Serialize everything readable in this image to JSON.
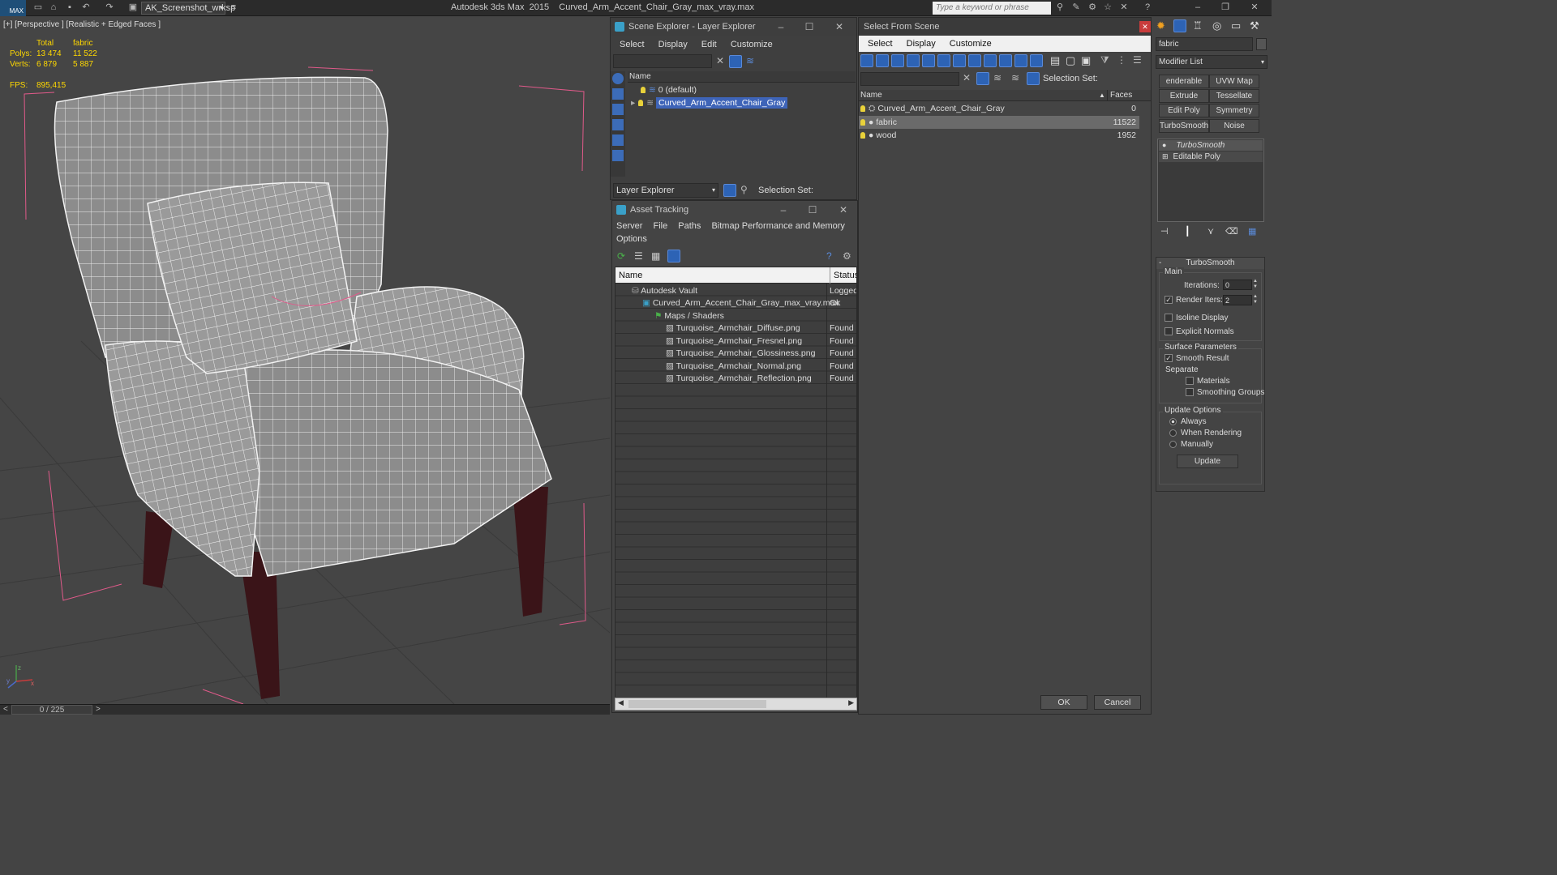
{
  "titlebar": {
    "logo": "MAX",
    "workspace": "AK_Screenshot_wrksp",
    "app_title": "Autodesk 3ds Max  2015    Curved_Arm_Accent_Chair_Gray_max_vray.max",
    "search_placeholder": "Type a keyword or phrase"
  },
  "viewport": {
    "label": "[+] [Perspective ] [Realistic + Edged Faces ]",
    "stats": {
      "col_total": "Total",
      "col_fabric": "fabric",
      "polys_label": "Polys:",
      "polys_total": "13 474",
      "polys_fabric": "11 522",
      "verts_label": "Verts:",
      "verts_total": "6 879",
      "verts_fabric": "5 887",
      "fps_label": "FPS:",
      "fps_value": "895,415"
    },
    "axis_x": "x",
    "axis_y": "y",
    "axis_z": "z"
  },
  "timeline": {
    "frame": "0 / 225",
    "prev": "<",
    "next": ">"
  },
  "scene_explorer": {
    "title": "Scene Explorer - Layer Explorer",
    "menu": [
      "Select",
      "Display",
      "Edit",
      "Customize"
    ],
    "col_name": "Name",
    "layers": [
      "0 (default)",
      "Curved_Arm_Accent_Chair_Gray"
    ],
    "footer_label": "Layer Explorer",
    "selection_set": "Selection Set:"
  },
  "asset_tracking": {
    "title": "Asset Tracking",
    "menu": [
      "Server",
      "File",
      "Paths",
      "Bitmap Performance and Memory"
    ],
    "menu2": "Options",
    "col_name": "Name",
    "col_status": "Status",
    "rows": [
      {
        "name": "Autodesk Vault",
        "status": "Logged"
      },
      {
        "name": "Curved_Arm_Accent_Chair_Gray_max_vray.max",
        "status": "Ok"
      },
      {
        "name": "Maps / Shaders",
        "status": ""
      },
      {
        "name": "Turquoise_Armchair_Diffuse.png",
        "status": "Found"
      },
      {
        "name": "Turquoise_Armchair_Fresnel.png",
        "status": "Found"
      },
      {
        "name": "Turquoise_Armchair_Glossiness.png",
        "status": "Found"
      },
      {
        "name": "Turquoise_Armchair_Normal.png",
        "status": "Found"
      },
      {
        "name": "Turquoise_Armchair_Reflection.png",
        "status": "Found"
      }
    ]
  },
  "select_from_scene": {
    "title": "Select From Scene",
    "menu": [
      "Select",
      "Display",
      "Customize"
    ],
    "selection_set": "Selection Set:",
    "col_name": "Name",
    "col_faces": "Faces",
    "rows": [
      {
        "name": "Curved_Arm_Accent_Chair_Gray",
        "faces": "0"
      },
      {
        "name": "fabric",
        "faces": "11522"
      },
      {
        "name": "wood",
        "faces": "1952"
      }
    ],
    "ok": "OK",
    "cancel": "Cancel"
  },
  "command_panel": {
    "object_name": "fabric",
    "modifier_list": "Modifier List",
    "buttons": [
      "enderable Spli",
      "UVW Map",
      "Extrude",
      "Tessellate",
      "Edit Poly",
      "Symmetry",
      "TurboSmooth",
      "Noise"
    ],
    "stack": [
      "TurboSmooth",
      "Editable Poly"
    ],
    "rollout_title": "TurboSmooth",
    "main_label": "Main",
    "iterations_label": "Iterations:",
    "iterations_value": "0",
    "render_iters_label": "Render Iters:",
    "render_iters_value": "2",
    "isoline": "Isoline Display",
    "explicit_normals": "Explicit Normals",
    "surface_params": "Surface Parameters",
    "smooth_result": "Smooth Result",
    "separate": "Separate",
    "materials": "Materials",
    "smoothing_groups": "Smoothing Groups",
    "update_options": "Update Options",
    "always": "Always",
    "when_rendering": "When Rendering",
    "manually": "Manually",
    "update": "Update"
  }
}
